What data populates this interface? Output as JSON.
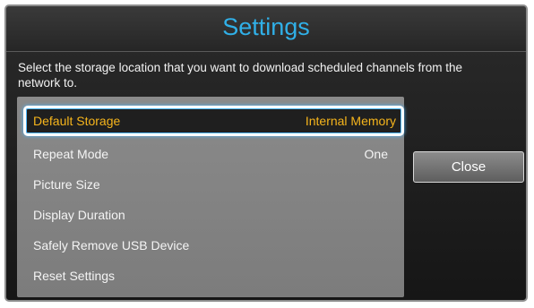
{
  "dialog": {
    "title": "Settings",
    "description": "Select the storage location that you want to download scheduled channels from the network to."
  },
  "menu": {
    "items": [
      {
        "label": "Default Storage",
        "value": "Internal Memory",
        "selected": true
      },
      {
        "label": "Repeat Mode",
        "value": "One"
      },
      {
        "label": "Picture Size",
        "value": ""
      },
      {
        "label": "Display Duration",
        "value": ""
      },
      {
        "label": "Safely Remove USB Device",
        "value": ""
      },
      {
        "label": "Reset Settings",
        "value": ""
      }
    ]
  },
  "buttons": {
    "close_label": "Close"
  },
  "colors": {
    "title": "#30b0e8",
    "selected_text": "#f6b51c",
    "focus_glow": "#4fb8ff",
    "panel": "#838383",
    "background": "#1e1e1e"
  }
}
